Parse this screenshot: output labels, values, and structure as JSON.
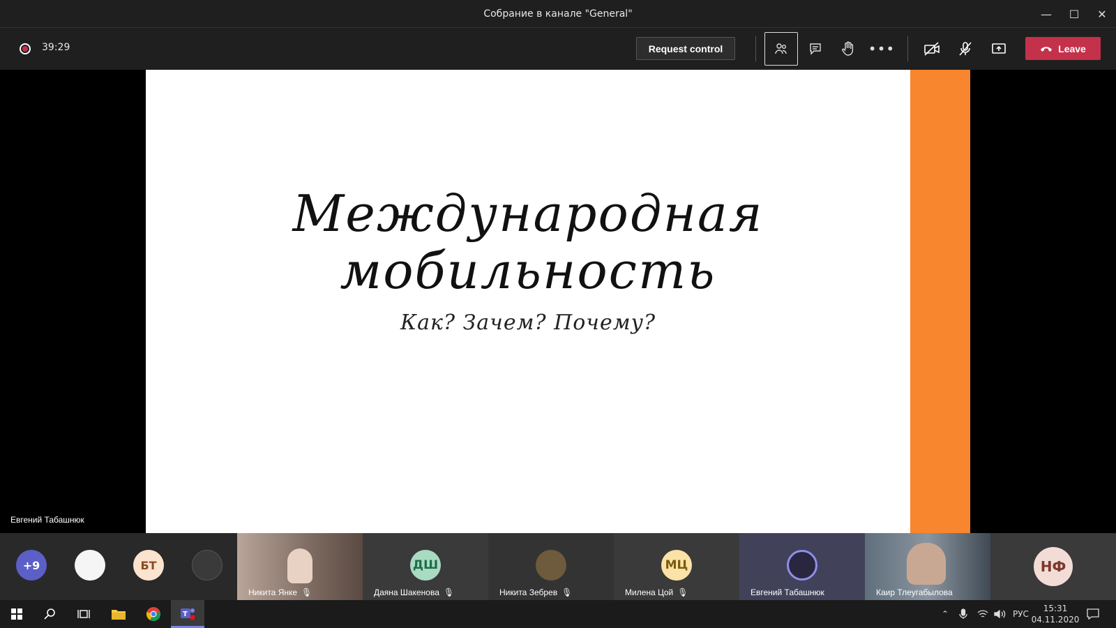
{
  "window": {
    "title": "Собрание в канале \"General\""
  },
  "toolbar": {
    "timer": "39:29",
    "request_control": "Request control",
    "leave": "Leave"
  },
  "slide": {
    "title_line1": "Международная",
    "title_line2": "мобильность",
    "subtitle": "Как? Зачем? Почему?",
    "accent_color": "#f7862e"
  },
  "stage": {
    "speaker_name": "Евгений Табашнюк"
  },
  "strip": {
    "overflow_count": "+9",
    "small_avatars": [
      {
        "initials": "",
        "color": "#f5f5f5"
      },
      {
        "initials": "БТ",
        "color": "#fbe4cf"
      },
      {
        "initials": "",
        "color": "#3a3a3a"
      }
    ],
    "tiles": [
      {
        "name": "Никита Янке",
        "initials": "",
        "muted": true
      },
      {
        "name": "Даяна Шакенова",
        "initials": "ДШ",
        "muted": true
      },
      {
        "name": "Никита Зебрев",
        "initials": "",
        "muted": true
      },
      {
        "name": "Милена Цой",
        "initials": "МЦ",
        "muted": true
      },
      {
        "name": "Евгений Табашнюк",
        "initials": "",
        "muted": false
      },
      {
        "name": "Каир Тлеугабылова",
        "initials": "",
        "muted": false
      },
      {
        "name": "",
        "initials": "НФ",
        "muted": false
      }
    ]
  },
  "taskbar": {
    "language": "РУС",
    "time": "15:31",
    "date": "04.11.2020"
  }
}
